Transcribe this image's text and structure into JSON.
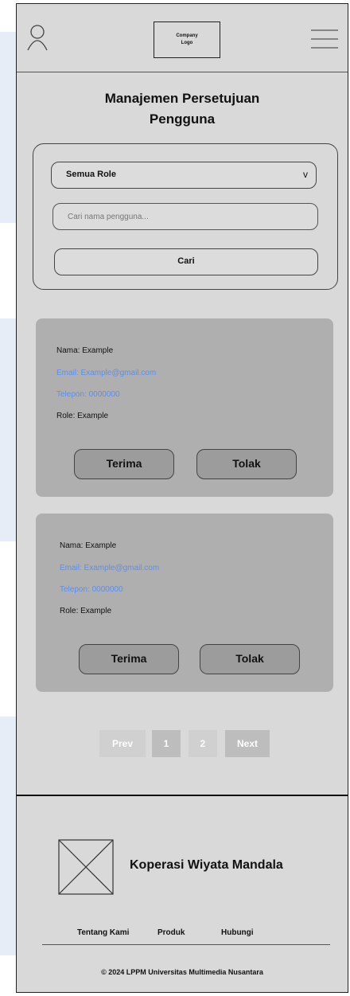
{
  "header": {
    "logo_line1": "Company",
    "logo_line2": "Logo"
  },
  "page": {
    "title_line1": "Manajemen Persetujuan",
    "title_line2": "Pengguna"
  },
  "filter": {
    "role_select_value": "Semua Role",
    "search_placeholder": "Cari nama pengguna...",
    "search_button": "Cari"
  },
  "cards": [
    {
      "name": "Nama: Example",
      "email": "Email: Example@gmail.com",
      "phone": "Telepon: 0000000",
      "role": "Role: Example",
      "accept": "Terima",
      "reject": "Tolak"
    },
    {
      "name": "Nama: Example",
      "email": "Email: Example@gmail.com",
      "phone": "Telepon: 0000000",
      "role": "Role: Example",
      "accept": "Terima",
      "reject": "Tolak"
    }
  ],
  "pagination": {
    "prev": "Prev",
    "page1": "1",
    "page2": "2",
    "next": "Next"
  },
  "footer": {
    "org_name": "Koperasi Wiyata Mandala",
    "links": [
      "Tentang Kami",
      "Produk",
      "Hubungi"
    ],
    "copyright": "© 2024 LPPM Universitas Multimedia Nusantara"
  },
  "colors": {
    "background": "#d9d9d9",
    "card": "#afafaf",
    "button": "#9c9c9c",
    "link": "#5b8ff0",
    "page_active": "#bdbdbd",
    "page_inactive": "#d0d0d0"
  }
}
